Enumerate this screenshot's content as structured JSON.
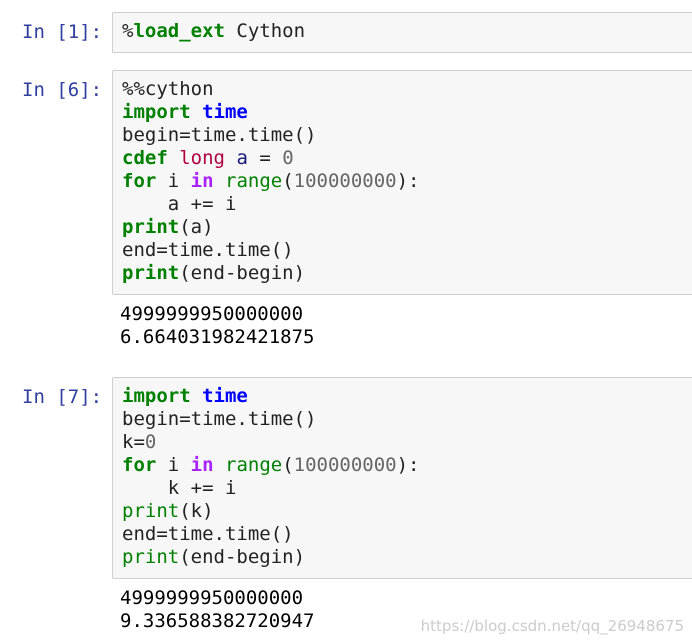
{
  "cells": [
    {
      "prompt": "In [1]:",
      "code": [
        [
          {
            "t": "%",
            "c": "magic"
          },
          {
            "t": "load_ext",
            "c": "magic-name"
          },
          {
            "t": " Cython",
            "c": ""
          }
        ]
      ],
      "output": []
    },
    {
      "prompt": "In [6]:",
      "code": [
        [
          {
            "t": "%%cython",
            "c": "magic"
          }
        ],
        [
          {
            "t": "import",
            "c": "kw"
          },
          {
            "t": " ",
            "c": ""
          },
          {
            "t": "time",
            "c": "nm"
          }
        ],
        [
          {
            "t": "begin=time.time()",
            "c": ""
          }
        ],
        [
          {
            "t": "cdef",
            "c": "kw"
          },
          {
            "t": " ",
            "c": ""
          },
          {
            "t": "long",
            "c": "ty"
          },
          {
            "t": " ",
            "c": ""
          },
          {
            "t": "a",
            "c": "var"
          },
          {
            "t": " = ",
            "c": ""
          },
          {
            "t": "0",
            "c": "num"
          }
        ],
        [
          {
            "t": "for",
            "c": "kw"
          },
          {
            "t": " i ",
            "c": ""
          },
          {
            "t": "in",
            "c": "op"
          },
          {
            "t": " ",
            "c": ""
          },
          {
            "t": "range",
            "c": "bi"
          },
          {
            "t": "(",
            "c": ""
          },
          {
            "t": "100000000",
            "c": "num"
          },
          {
            "t": "):",
            "c": ""
          }
        ],
        [
          {
            "t": "    a += i",
            "c": ""
          }
        ],
        [
          {
            "t": "print",
            "c": "kw"
          },
          {
            "t": "(a)",
            "c": ""
          }
        ],
        [
          {
            "t": "end=time.time()",
            "c": ""
          }
        ],
        [
          {
            "t": "print",
            "c": "kw"
          },
          {
            "t": "(end-begin)",
            "c": ""
          }
        ]
      ],
      "output": [
        "4999999950000000",
        "6.664031982421875"
      ]
    },
    {
      "prompt": "In [7]:",
      "code": [
        [
          {
            "t": "import",
            "c": "kw"
          },
          {
            "t": " ",
            "c": ""
          },
          {
            "t": "time",
            "c": "nm"
          }
        ],
        [
          {
            "t": "begin=time.time()",
            "c": ""
          }
        ],
        [
          {
            "t": "k=",
            "c": ""
          },
          {
            "t": "0",
            "c": "num"
          }
        ],
        [
          {
            "t": "for",
            "c": "kw"
          },
          {
            "t": " i ",
            "c": ""
          },
          {
            "t": "in",
            "c": "op"
          },
          {
            "t": " ",
            "c": ""
          },
          {
            "t": "range",
            "c": "bi"
          },
          {
            "t": "(",
            "c": ""
          },
          {
            "t": "100000000",
            "c": "num"
          },
          {
            "t": "):",
            "c": ""
          }
        ],
        [
          {
            "t": "    k += i",
            "c": ""
          }
        ],
        [
          {
            "t": "print",
            "c": "bi"
          },
          {
            "t": "(k)",
            "c": ""
          }
        ],
        [
          {
            "t": "end=time.time()",
            "c": ""
          }
        ],
        [
          {
            "t": "print",
            "c": "bi"
          },
          {
            "t": "(end-begin)",
            "c": ""
          }
        ]
      ],
      "output": [
        "4999999950000000",
        "9.336588382720947"
      ]
    }
  ],
  "watermark": "https://blog.csdn.net/qq_26948675"
}
